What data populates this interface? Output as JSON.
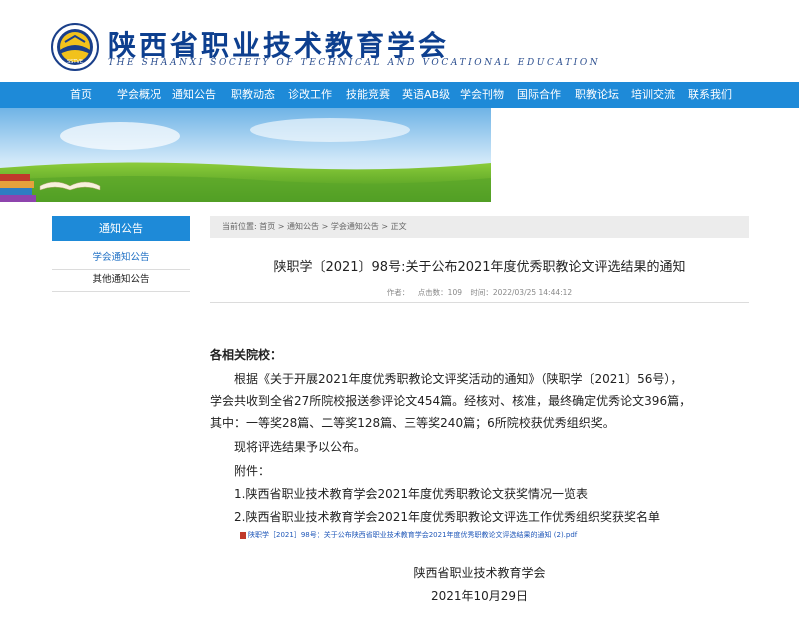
{
  "header": {
    "title": "陕西省职业技术教育学会",
    "subtitle": "THE SHAANXI SOCIETY OF TECHNICAL AND VOCATIONAL EDUCATION",
    "logo_text": "SSTVE",
    "brand_color": "#0d3f8f"
  },
  "nav": {
    "color": "#1e8ad8",
    "items": [
      "首页",
      "学会概况",
      "通知公告",
      "职教动态",
      "诊改工作",
      "技能竞赛",
      "英语AB级",
      "学会刊物",
      "国际合作",
      "职教论坛",
      "培训交流",
      "联系我们"
    ]
  },
  "sidebar": {
    "heading": "通知公告",
    "items": [
      {
        "label": "学会通知公告",
        "active": true
      },
      {
        "label": "其他通知公告",
        "active": false
      }
    ]
  },
  "breadcrumb": [
    "当前位置:",
    "首页",
    ">",
    "通知公告",
    ">",
    "学会通知公告",
    ">",
    "正文"
  ],
  "article": {
    "title": "陕职学〔2021〕98号:关于公布2021年度优秀职教论文评选结果的通知",
    "meta_author": "作者：",
    "meta_clicks": "点击数：109",
    "meta_time": "时间：2022/03/25 14:44:12",
    "salutation": "各相关院校：",
    "paragraph_lines": [
      "　　根据《关于开展2021年度优秀职教论文评奖活动的通知》（陕职学〔2021〕56号），",
      "学会共收到全省27所院校报送参评论文454篇。经核对、核准，最终确定优秀论文396篇，",
      "其中：一等奖28篇、二等奖128篇、三等奖240篇；6所院校获优秀组织奖。"
    ],
    "announce": "　　现将评选结果予以公布。",
    "attachment_label": "　　附件：",
    "attachments": [
      "　　1.陕西省职业技术教育学会2021年度优秀职教论文获奖情况一览表",
      "　　2.陕西省职业技术教育学会2021年度优秀职教论文评选工作优秀组织奖获奖名单"
    ],
    "pdf_link": "陕职学［2021］98号：关于公布陕西省职业技术教育学会2021年度优秀职教论文评选结果的通知 (2).pdf",
    "signature": "陕西省职业技术教育学会",
    "date": "2021年10月29日"
  }
}
